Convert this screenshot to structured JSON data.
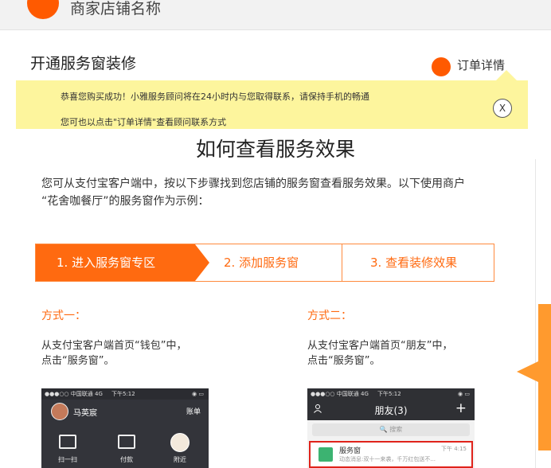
{
  "header": {
    "shop_name": "商家店铺名称"
  },
  "page": {
    "title": "开通服务窗装修",
    "order_link": "订单详情"
  },
  "notice": {
    "line1": "恭喜您购买成功！小雅服务顾问将在24小时内与您取得联系，请保持手机的畅通",
    "line2": "您可也以点击\"订单详情\"查看顾问联系方式",
    "close_label": "X"
  },
  "content": {
    "title": "如何查看服务效果",
    "intro_line1": "您可从支付宝客户端中，按以下步骤找到您店铺的服务窗查看服务效果。以下使用商户",
    "intro_line2": "“花舍咖餐厅”的服务窗作为示例：",
    "steps": [
      "1. 进入服务窗专区",
      "2. 添加服务窗",
      "3. 查看装修效果"
    ],
    "methods": [
      {
        "title": "方式一：",
        "desc_line1": "从支付宝客户端首页“钱包”中，",
        "desc_line2": "点击“服务窗”。"
      },
      {
        "title": "方式二：",
        "desc_line1": "从支付宝客户端首页“朋友”中，",
        "desc_line2": "点击“服务窗”。"
      }
    ]
  },
  "phone_a": {
    "carrier": "●●●○○ 中国联通  4G",
    "time": "下午5:12",
    "status_icons": "◉ ▭",
    "user": "马英宸",
    "bill_label": "账单",
    "icons": [
      "扫一扫",
      "付款",
      "附近"
    ]
  },
  "phone_b": {
    "carrier": "●●●○○ 中国联通  4G",
    "time": "下午5:12",
    "status_icons": "◉ ▭",
    "add_friend_icon": "person-add",
    "title": "朋友(3)",
    "plus": "+",
    "search_placeholder": "🔍 搜索",
    "item_name": "服务窗",
    "item_time": "下午 4:15",
    "item_msg": "动态消息:双十一来袭，千万红包送不..."
  },
  "colors": {
    "brand_orange": "#ff6a10",
    "notice_yellow": "#fdf59d"
  }
}
